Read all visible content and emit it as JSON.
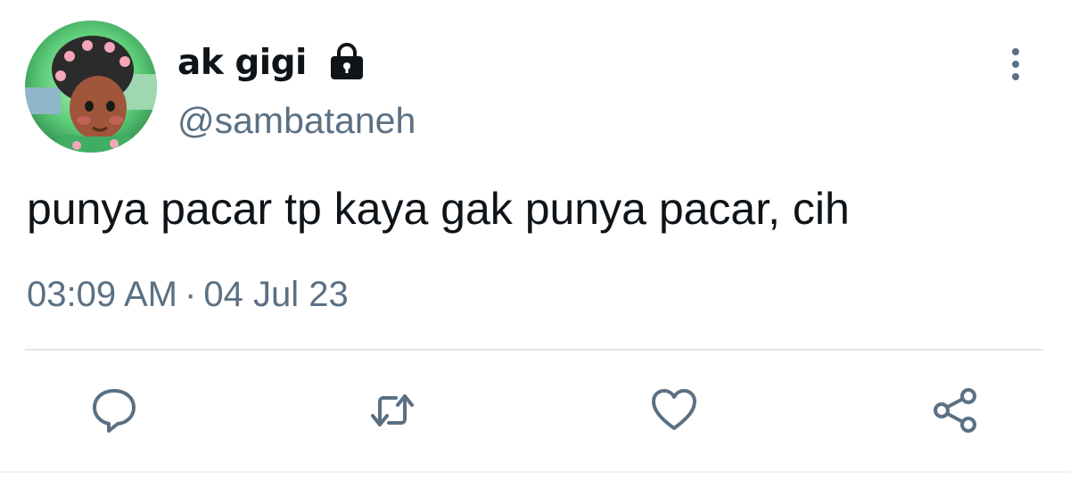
{
  "author": {
    "display_name": "ak gigi",
    "handle": "@sambataneh",
    "protected": true,
    "avatar_icon": "avatar-illustration"
  },
  "tweet": {
    "text": "punya pacar tp kaya gak punya pacar, cih",
    "time": "03:09 AM",
    "separator": "·",
    "date": "04 Jul 23"
  },
  "icons": {
    "more": "more-vertical-icon",
    "reply": "reply-icon",
    "retweet": "retweet-icon",
    "like": "heart-icon",
    "share": "share-icon",
    "lock": "lock-icon"
  },
  "colors": {
    "text_primary": "#0f1419",
    "text_secondary": "#5b7083",
    "divider": "#e1e8ed"
  }
}
